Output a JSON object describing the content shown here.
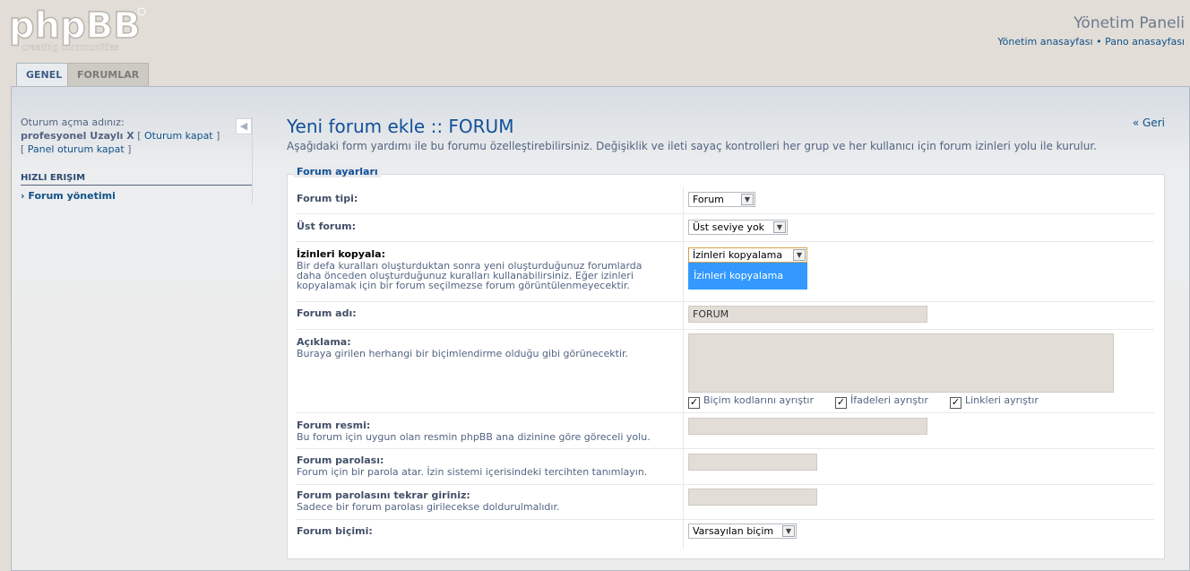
{
  "header": {
    "logo_text": "phpBB",
    "logo_tagline": "creating communities",
    "title": "Yönetim Paneli",
    "link_admin_home": "Yönetim anasayfası",
    "bullet": "•",
    "link_board_home": "Pano anasayfası"
  },
  "tabs": [
    {
      "label": "GENEL",
      "active": true
    },
    {
      "label": "FORUMLAR",
      "active": false
    }
  ],
  "sidebar": {
    "login_label": "Oturum açma adınız:",
    "username": "profesyonel Uzaylı X",
    "logout_link": "Oturum kapat",
    "panel_logout_link": "Panel oturum kapat",
    "bracket_open": "[",
    "bracket_close": "]",
    "collapse_icon": "◀",
    "quick_access_title": "HIZLI ERIŞIM",
    "quick_items": [
      {
        "bullet": "›",
        "label": "Forum yönetimi"
      }
    ]
  },
  "main": {
    "title": "Yeni forum ekle :: FORUM",
    "back_link": "« Geri",
    "description": "Aşağıdaki form yardımı ile bu forumu özelleştirebilirsiniz. Değişiklik ve ileti sayaç kontrolleri her grup ve her kullanıcı için forum izinleri yolu ile kurulur.",
    "fieldset_legend": "Forum ayarları",
    "fields": {
      "forum_type": {
        "label": "Forum tipi:",
        "value": "Forum"
      },
      "parent": {
        "label": "Üst forum:",
        "value": "Üst seviye yok"
      },
      "copy_perm": {
        "label": "İzinleri kopyala:",
        "explain_1": "Bir defa kuralları oluşturduktan sonra yeni oluşturduğunuz forumlarda",
        "explain_2": "daha önceden oluşturduğunuz kuralları kullanabilirsiniz. Eğer izinleri",
        "explain_3": "kopyalamak için bir forum seçilmezse forum görüntülenmeyecektir.",
        "value": "İzinleri kopyalama",
        "dropdown_option": "İzinleri kopyalama"
      },
      "forum_name": {
        "label": "Forum adı:",
        "value": "FORUM"
      },
      "description": {
        "label": "Açıklama:",
        "explain": "Buraya girilen herhangi bir biçimlendirme olduğu gibi görünecektir.",
        "value": "",
        "options": [
          {
            "label": "Biçim kodlarını ayrıştır",
            "checked": true
          },
          {
            "label": "İfadeleri ayrıştır",
            "checked": true
          },
          {
            "label": "Linkleri ayrıştır",
            "checked": true
          }
        ]
      },
      "forum_image": {
        "label": "Forum resmi:",
        "explain": "Bu forum için uygun olan resmin phpBB ana dizinine göre göreceli yolu.",
        "value": ""
      },
      "password": {
        "label": "Forum parolası:",
        "explain": "Forum için bir parola atar. İzin sistemi içerisindeki tercihten tanımlayın.",
        "value": ""
      },
      "password_confirm": {
        "label": "Forum parolasını tekrar giriniz:",
        "explain": "Sadece bir forum parolası girilecekse doldurulmalıdır.",
        "value": ""
      },
      "style": {
        "label": "Forum biçimi:",
        "value": "Varsayılan biçim"
      }
    },
    "select_arrow_icon": "▼",
    "check_mark": "✓"
  }
}
